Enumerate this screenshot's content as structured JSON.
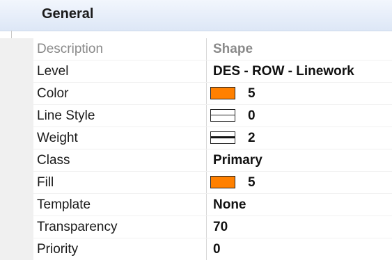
{
  "section": {
    "title": "General"
  },
  "colors": {
    "swatch_orange": "#ff8000",
    "header_bg": "#dde7f6"
  },
  "properties": [
    {
      "name": "Description",
      "value": "Shape",
      "dim": true,
      "swatch": ""
    },
    {
      "name": "Level",
      "value": "DES - ROW - Linework",
      "dim": false,
      "swatch": ""
    },
    {
      "name": "Color",
      "value": "5",
      "dim": false,
      "swatch": "color"
    },
    {
      "name": "Line Style",
      "value": "0",
      "dim": false,
      "swatch": "linestyle"
    },
    {
      "name": "Weight",
      "value": "2",
      "dim": false,
      "swatch": "weight"
    },
    {
      "name": "Class",
      "value": "Primary",
      "dim": false,
      "swatch": ""
    },
    {
      "name": "Fill",
      "value": "5",
      "dim": false,
      "swatch": "color"
    },
    {
      "name": "Template",
      "value": "None",
      "dim": false,
      "swatch": ""
    },
    {
      "name": "Transparency",
      "value": "70",
      "dim": false,
      "swatch": ""
    },
    {
      "name": "Priority",
      "value": "0",
      "dim": false,
      "swatch": ""
    }
  ]
}
